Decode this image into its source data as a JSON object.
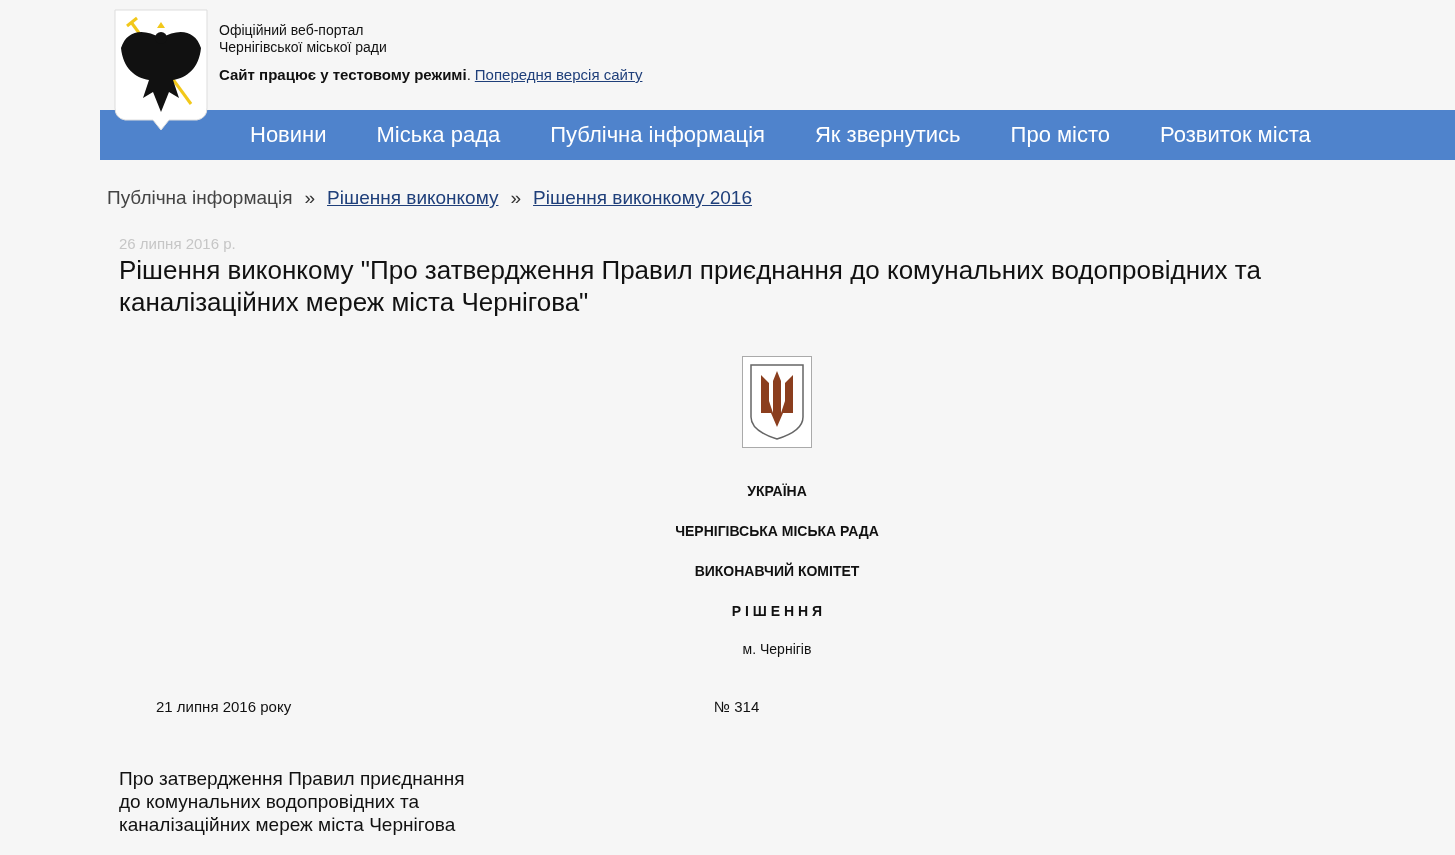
{
  "header": {
    "portal_title": "Офіційний веб-портал",
    "portal_subtitle": "Чернігівської міської ради",
    "notice": "Сайт працює у тестовому режимі",
    "notice_punct": ".",
    "previous_link": "Попередня версія сайту"
  },
  "nav": [
    "Новини",
    "Міська рада",
    "Публічна інформація",
    "Як звернутись",
    "Про місто",
    "Розвиток міста"
  ],
  "breadcrumb": [
    {
      "label": "Публічна інформація",
      "kind": "text"
    },
    {
      "label": "Рішення виконкому",
      "kind": "link"
    },
    {
      "label": "Рішення виконкому 2016",
      "kind": "link"
    }
  ],
  "breadcrumb_separator": "»",
  "article": {
    "date": "26 липня 2016 р.",
    "title": "Рішення виконкому \"Про затвердження Правил приєднання до комунальних водопровідних та каналізаційних мереж міста Чернігова\""
  },
  "document": {
    "heading_lines": [
      {
        "text": "УКРАЇНА",
        "kind": "bold"
      },
      {
        "text": "ЧЕРНІГІВСЬКА МІСЬКА РАДА",
        "kind": "bold"
      },
      {
        "text": "ВИКОНАВЧИЙ КОМІТЕТ",
        "kind": "bold"
      },
      {
        "text": "Р І Ш Е Н Н Я",
        "kind": "bold"
      },
      {
        "text": "м. Чернігів",
        "kind": "plain"
      }
    ],
    "decision_date": "21 липня 2016 року",
    "decision_number": "№ 314",
    "subject": "Про затвердження Правил приєднання до комунальних водопровідних та каналізаційних мереж міста Чернігова"
  }
}
